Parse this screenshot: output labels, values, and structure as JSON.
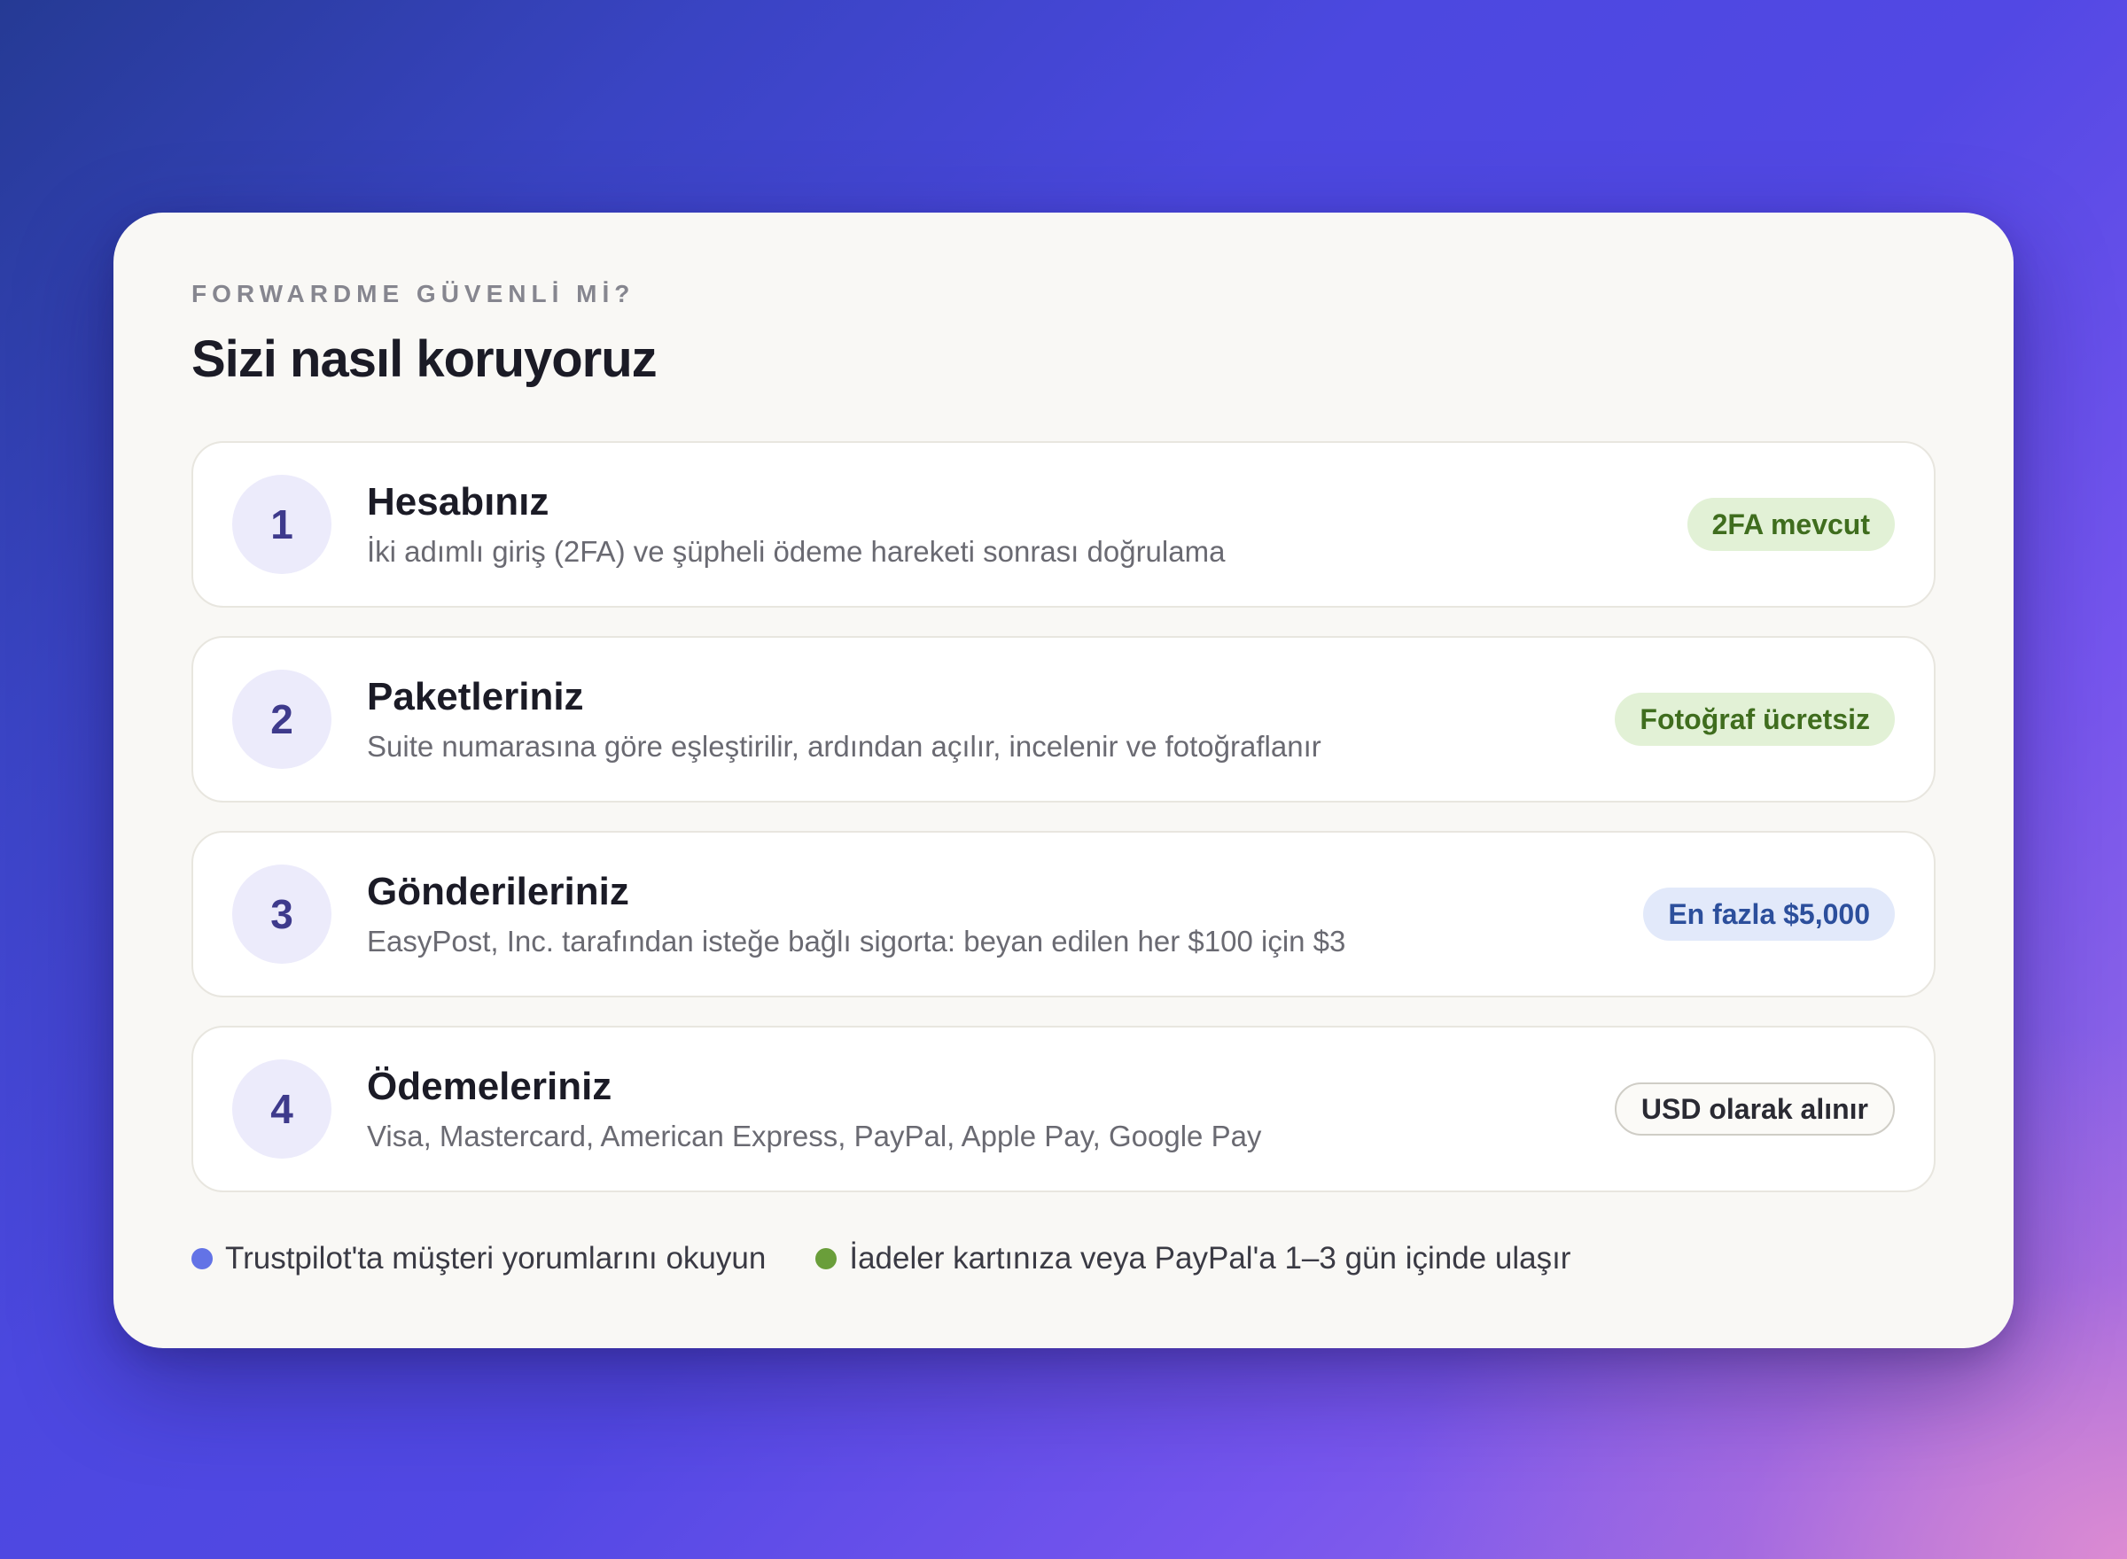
{
  "section": {
    "eyebrow": "FORWARDME GÜVENLİ Mİ?",
    "title": "Sizi nasıl koruyoruz"
  },
  "items": [
    {
      "number": "1",
      "title": "Hesabınız",
      "description": "İki adımlı giriş (2FA) ve şüpheli ödeme hareketi sonrası doğrulama",
      "badge": "2FA mevcut",
      "badge_style": "green"
    },
    {
      "number": "2",
      "title": "Paketleriniz",
      "description": "Suite numarasına göre eşleştirilir, ardından açılır, incelenir ve fotoğraflanır",
      "badge": "Fotoğraf ücretsiz",
      "badge_style": "green"
    },
    {
      "number": "3",
      "title": "Gönderileriniz",
      "description": "EasyPost, Inc. tarafından isteğe bağlı sigorta: beyan edilen her $100 için $3",
      "badge": "En fazla $5,000",
      "badge_style": "blue"
    },
    {
      "number": "4",
      "title": "Ödemeleriniz",
      "description": "Visa, Mastercard, American Express, PayPal, Apple Pay, Google Pay",
      "badge": "USD olarak alınır",
      "badge_style": "outline"
    }
  ],
  "footer": {
    "links": [
      {
        "text": "Trustpilot'ta müşteri yorumlarını okuyun",
        "dot_color": "#6373e6"
      },
      {
        "text": "İadeler kartınıza veya PayPal'a 1–3 gün içinde ulaşır",
        "dot_color": "#6a9e3a"
      }
    ]
  },
  "colors": {
    "accent_number_bg": "#ecebfb",
    "accent_number_text": "#3e3a8c",
    "badge_green_bg": "#e2f1d6",
    "badge_green_text": "#3f6d1e",
    "badge_blue_bg": "#e2e9fa",
    "badge_blue_text": "#2c4f9c"
  }
}
